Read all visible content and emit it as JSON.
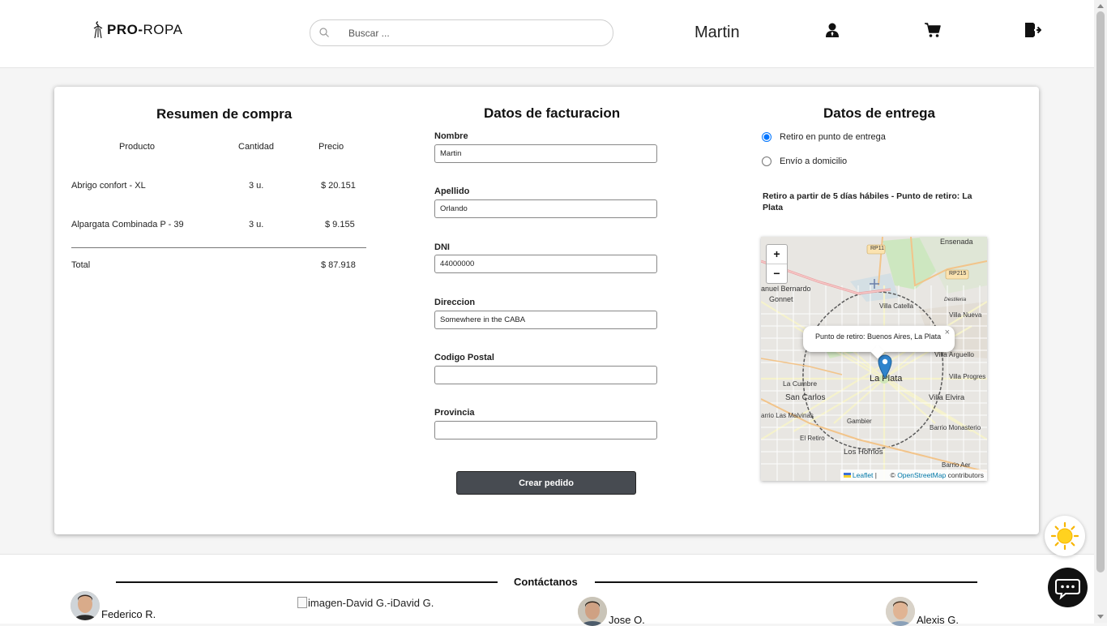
{
  "header": {
    "brand_bold": "PRO-",
    "brand_rest": "ROPA",
    "search_placeholder": "Buscar ...",
    "username": "Martin",
    "icons": [
      "user-icon",
      "cart-icon",
      "logout-icon"
    ]
  },
  "summary": {
    "title": "Resumen de compra",
    "columns": [
      "Producto",
      "Cantidad",
      "Precio"
    ],
    "rows": [
      {
        "product": "Abrigo confort - XL",
        "qty": "3 u.",
        "price": "$ 20.151"
      },
      {
        "product": "Alpargata Combinada P - 39",
        "qty": "3 u.",
        "price": "$ 9.155"
      }
    ],
    "total_label": "Total",
    "total_value": "$ 87.918"
  },
  "billing": {
    "title": "Datos de facturacion",
    "fields": [
      {
        "label": "Nombre",
        "value": "Martin"
      },
      {
        "label": "Apellido",
        "value": "Orlando"
      },
      {
        "label": "DNI",
        "value": "44000000"
      },
      {
        "label": "Direccion",
        "value": "Somewhere in the CABA"
      },
      {
        "label": "Codigo Postal",
        "value": ""
      },
      {
        "label": "Provincia",
        "value": ""
      }
    ],
    "submit_label": "Crear pedido"
  },
  "delivery": {
    "title": "Datos de entrega",
    "options": [
      {
        "label": "Retiro en punto de entrega",
        "checked": true
      },
      {
        "label": "Envío a domicilio",
        "checked": false
      }
    ],
    "note": "Retiro a partir de 5 días hábiles - Punto de retiro: La Plata",
    "map": {
      "popup_text": "Punto de retiro: Buenos Aires, La Plata",
      "popup_close": "×",
      "zoom_in": "+",
      "zoom_out": "−",
      "labels": {
        "ensenada": "Ensenada",
        "rp11": "RP11",
        "rp215": "RP215",
        "manuel_bernardo": "anuel Bernardo",
        "gonnet": "Gonnet",
        "villa_catella": "Villa Catella",
        "destileria": "Destileria",
        "villa_nueva": "Villa Nueva",
        "villa_arguello": "Villa Arguello",
        "la_cumbre": "La Cumbre",
        "la_plata": "La Plata",
        "villa_progreso": "Villa Progres",
        "san_carlos": "San Carlos",
        "villa_elvira": "Villa Elvira",
        "las_malvinas": "arrio Las Malvinas",
        "gambier": "Gambier",
        "barrio_monasterio": "Barrio Monasterio",
        "el_retiro": "El Retiro",
        "los_hornos": "Los Hornos",
        "barrio_aeropuerto": "Barrio Aer"
      },
      "attribution_leaflet": "Leaflet",
      "attribution_sep": "|",
      "attribution_copy": "©",
      "attribution_osm": "OpenStreetMap",
      "attribution_rest": "contributors"
    }
  },
  "footer": {
    "contact_title": "Contáctanos",
    "people": [
      {
        "name": "Federico R."
      },
      {
        "name": "imagen-David G.-iDavid G."
      },
      {
        "name": "Jose O."
      },
      {
        "name": "Alexis G."
      }
    ]
  },
  "floating": {
    "theme_toggle": "sun-icon",
    "chat": "chat-icon"
  }
}
